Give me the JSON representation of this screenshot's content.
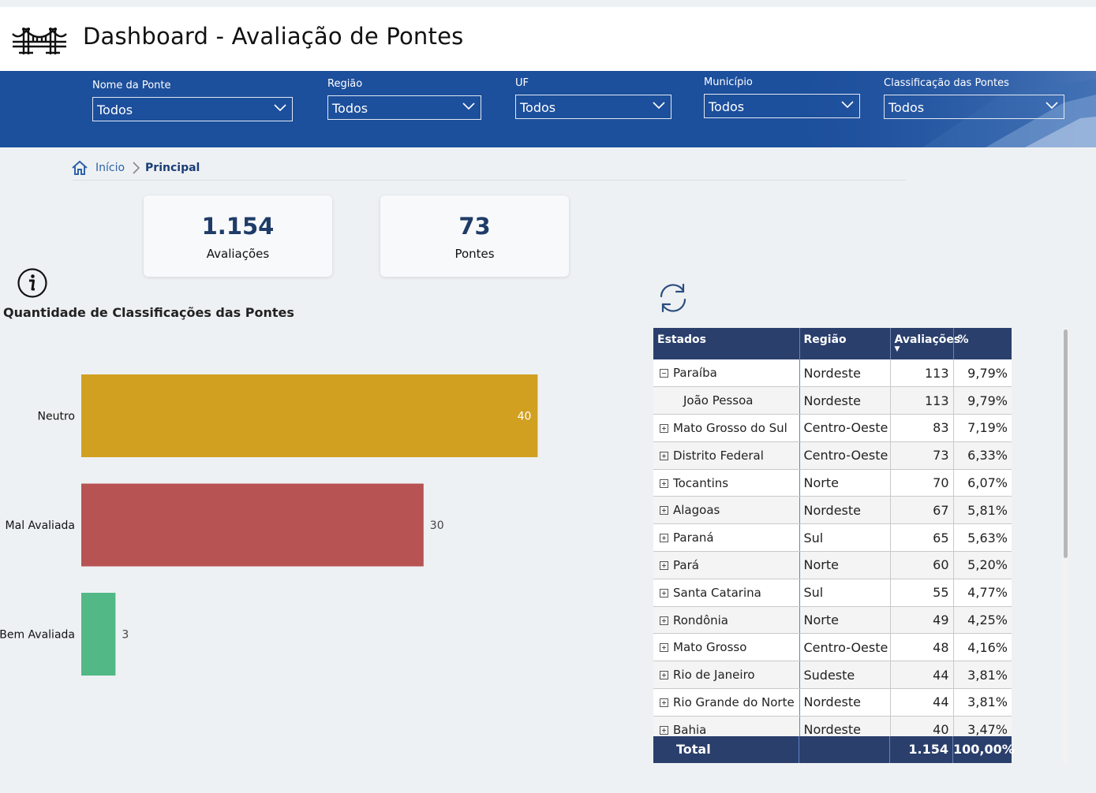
{
  "header": {
    "title": "Dashboard - Avaliação de Pontes"
  },
  "filters": [
    {
      "label": "Nome da Ponte",
      "value": "Todos"
    },
    {
      "label": "Região",
      "value": "Todos"
    },
    {
      "label": "UF",
      "value": "Todos"
    },
    {
      "label": "Município",
      "value": "Todos"
    },
    {
      "label": "Classificação das Pontes",
      "value": "Todos"
    }
  ],
  "breadcrumb": {
    "home": "Início",
    "current": "Principal"
  },
  "kpis": [
    {
      "value": "1.154",
      "label": "Avaliações"
    },
    {
      "value": "73",
      "label": "Pontes"
    }
  ],
  "chart_title": "Quantidade de Classificações das Pontes",
  "chart_data": {
    "type": "bar",
    "orientation": "horizontal",
    "categories": [
      "Neutro",
      "Mal Avaliada",
      "Bem Avaliada"
    ],
    "values": [
      40,
      30,
      3
    ],
    "colors": [
      "#d1a020",
      "#b85353",
      "#52b986"
    ],
    "label_colors": [
      "#ffffff",
      "#444444",
      "#444444"
    ],
    "xlim": [
      0,
      50
    ]
  },
  "table": {
    "columns": [
      "Estados",
      "Região",
      "Avaliações",
      "%"
    ],
    "rows": [
      {
        "name": "Paraíba",
        "regiao": "Nordeste",
        "aval": "113",
        "pct": "9,79%",
        "type": "expanded"
      },
      {
        "name": "João Pessoa",
        "regiao": "Nordeste",
        "aval": "113",
        "pct": "9,79%",
        "type": "child"
      },
      {
        "name": "Mato Grosso do Sul",
        "regiao": "Centro-Oeste",
        "aval": "83",
        "pct": "7,19%",
        "type": "collapsed"
      },
      {
        "name": "Distrito Federal",
        "regiao": "Centro-Oeste",
        "aval": "73",
        "pct": "6,33%",
        "type": "collapsed"
      },
      {
        "name": "Tocantins",
        "regiao": "Norte",
        "aval": "70",
        "pct": "6,07%",
        "type": "collapsed"
      },
      {
        "name": "Alagoas",
        "regiao": "Nordeste",
        "aval": "67",
        "pct": "5,81%",
        "type": "collapsed"
      },
      {
        "name": "Paraná",
        "regiao": "Sul",
        "aval": "65",
        "pct": "5,63%",
        "type": "collapsed"
      },
      {
        "name": "Pará",
        "regiao": "Norte",
        "aval": "60",
        "pct": "5,20%",
        "type": "collapsed"
      },
      {
        "name": "Santa Catarina",
        "regiao": "Sul",
        "aval": "55",
        "pct": "4,77%",
        "type": "collapsed"
      },
      {
        "name": "Rondônia",
        "regiao": "Norte",
        "aval": "49",
        "pct": "4,25%",
        "type": "collapsed"
      },
      {
        "name": "Mato Grosso",
        "regiao": "Centro-Oeste",
        "aval": "48",
        "pct": "4,16%",
        "type": "collapsed"
      },
      {
        "name": "Rio de Janeiro",
        "regiao": "Sudeste",
        "aval": "44",
        "pct": "3,81%",
        "type": "collapsed"
      },
      {
        "name": "Rio Grande do Norte",
        "regiao": "Nordeste",
        "aval": "44",
        "pct": "3,81%",
        "type": "collapsed"
      },
      {
        "name": "Bahia",
        "regiao": "Nordeste",
        "aval": "40",
        "pct": "3,47%",
        "type": "collapsed"
      }
    ],
    "total": {
      "label": "Total",
      "aval": "1.154",
      "pct": "100,00%"
    }
  },
  "colors": {
    "filterbar": "#1c4f9c",
    "table_header": "#2a3f6c",
    "kpi_value": "#1f3c68"
  }
}
